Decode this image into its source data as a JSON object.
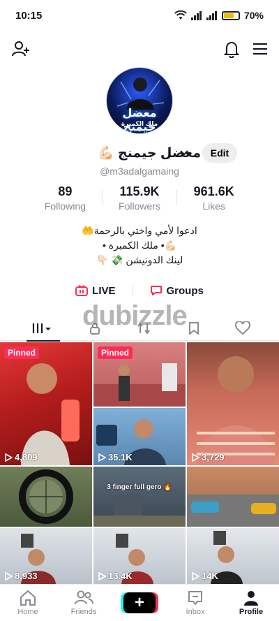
{
  "status_bar": {
    "time": "10:15",
    "battery_percent": "70%",
    "battery_level": 0.7
  },
  "profile": {
    "avatar_text_main": "معضل جيمنج",
    "avatar_text_sub": "ملك الكمبرة",
    "name": "معضل جيمنج 💪🏻",
    "handle": "@m3adalgamaing",
    "edit_label": "Edit"
  },
  "stats": [
    {
      "value": "89",
      "label": "Following"
    },
    {
      "value": "115.9K",
      "label": "Followers"
    },
    {
      "value": "961.6K",
      "label": "Likes"
    }
  ],
  "bio": {
    "line1": "ادعوا لأمي واختي بالرحمة🤲",
    "line2": "💪🏻• ملك الكمبرة •",
    "line3": "لينك الدونيشن 💸 👇🏻"
  },
  "links": {
    "live": "LIVE",
    "groups": "Groups"
  },
  "watermark": "dubizzle",
  "videos": [
    {
      "pinned": "Pinned",
      "views": "4,809",
      "caption": ""
    },
    {
      "pinned": "Pinned",
      "views": "",
      "caption": ""
    },
    {
      "pinned": "",
      "views": "3,729",
      "caption": ""
    },
    {
      "pinned": "",
      "views": "35.1K",
      "caption": ""
    },
    {
      "pinned": "",
      "views": "",
      "caption": ""
    },
    {
      "pinned": "",
      "views": "",
      "caption": "3 finger full gero 🔥"
    },
    {
      "pinned": "",
      "views": "",
      "caption": ""
    },
    {
      "pinned": "",
      "views": "8,933",
      "caption": ""
    },
    {
      "pinned": "",
      "views": "13.4K",
      "caption": ""
    },
    {
      "pinned": "",
      "views": "14K",
      "caption": ""
    }
  ],
  "nav": {
    "home": "Home",
    "friends": "Friends",
    "inbox": "Inbox",
    "profile": "Profile",
    "create": "+"
  },
  "colors": {
    "accent": "#fe2c55",
    "cyan": "#25f4ee",
    "text": "#161823",
    "muted": "#8a8b91"
  }
}
